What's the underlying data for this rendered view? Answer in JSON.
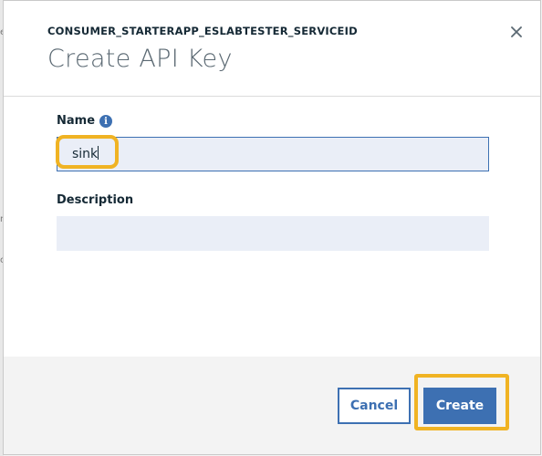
{
  "backdrop": {
    "fragments": [
      "e",
      "n",
      "c"
    ]
  },
  "modal": {
    "overline": "CONSUMER_STARTERAPP_ESLABTESTER_SERVICEID",
    "title": "Create API Key",
    "close_icon": "close-icon"
  },
  "form": {
    "name_label": "Name",
    "name_info_icon": "info-icon",
    "name_value": "sink",
    "description_label": "Description",
    "description_value": ""
  },
  "footer": {
    "cancel_label": "Cancel",
    "create_label": "Create"
  },
  "colors": {
    "accent": "#3d70b2",
    "highlight": "#f0b323",
    "input_bg": "#eaeef7",
    "footer_bg": "#f3f3f3"
  }
}
